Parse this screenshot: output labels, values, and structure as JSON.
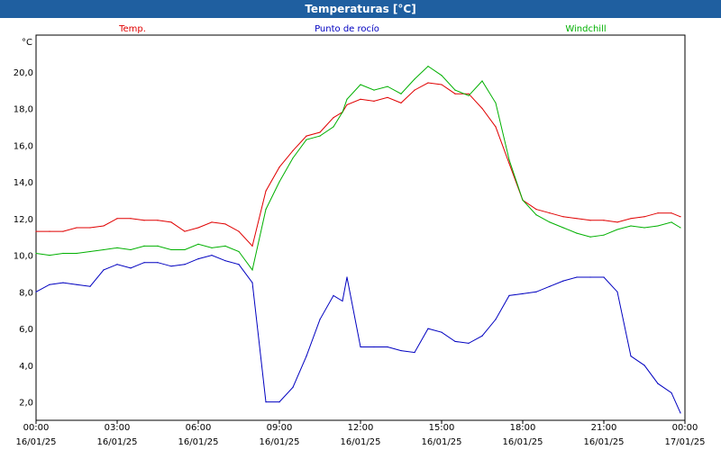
{
  "window": {
    "title": "Temperaturas [°C]"
  },
  "chart_data": {
    "type": "line",
    "title": "Temperaturas [°C]",
    "ylabel": "°C",
    "ylim": [
      1,
      22
    ],
    "xlim": [
      "16/01/25 00:00",
      "17/01/25 00:00"
    ],
    "grid": true,
    "legend": "top",
    "y_ticks": [
      "2,0",
      "4,0",
      "6,0",
      "8,0",
      "10,0",
      "12,0",
      "14,0",
      "16,0",
      "18,0",
      "20,0"
    ],
    "x_ticks": [
      {
        "time": "00:00",
        "date": "16/01/25"
      },
      {
        "time": "03:00",
        "date": "16/01/25"
      },
      {
        "time": "06:00",
        "date": "16/01/25"
      },
      {
        "time": "09:00",
        "date": "16/01/25"
      },
      {
        "time": "12:00",
        "date": "16/01/25"
      },
      {
        "time": "15:00",
        "date": "16/01/25"
      },
      {
        "time": "18:00",
        "date": "16/01/25"
      },
      {
        "time": "21:00",
        "date": "16/01/25"
      },
      {
        "time": "00:00",
        "date": "17/01/25"
      }
    ],
    "x": [
      "00:00",
      "00:30",
      "01:00",
      "01:30",
      "02:00",
      "02:30",
      "03:00",
      "03:30",
      "04:00",
      "04:30",
      "05:00",
      "05:30",
      "06:00",
      "06:30",
      "07:00",
      "07:30",
      "08:00",
      "08:30",
      "09:00",
      "09:30",
      "10:00",
      "10:30",
      "11:00",
      "11:20",
      "11:30",
      "12:00",
      "12:30",
      "13:00",
      "13:30",
      "14:00",
      "14:30",
      "15:00",
      "15:30",
      "16:00",
      "16:30",
      "17:00",
      "17:30",
      "18:00",
      "18:30",
      "19:00",
      "19:30",
      "20:00",
      "20:30",
      "21:00",
      "21:30",
      "22:00",
      "22:30",
      "23:00",
      "23:30",
      "23:50"
    ],
    "series": [
      {
        "name": "Temp.",
        "color": "#e00000",
        "values": [
          11.3,
          11.3,
          11.3,
          11.5,
          11.5,
          11.6,
          12.0,
          12.0,
          11.9,
          11.9,
          11.8,
          11.3,
          11.5,
          11.8,
          11.7,
          11.3,
          10.5,
          13.5,
          14.8,
          15.7,
          16.5,
          16.7,
          17.5,
          17.8,
          18.2,
          18.5,
          18.4,
          18.6,
          18.3,
          19.0,
          19.4,
          19.3,
          18.8,
          18.8,
          18.0,
          17.0,
          15.0,
          13.0,
          12.5,
          12.3,
          12.1,
          12.0,
          11.9,
          11.9,
          11.8,
          12.0,
          12.1,
          12.3,
          12.3,
          12.1
        ]
      },
      {
        "name": "Punto de rocío",
        "color": "#0000c0",
        "values": [
          8.0,
          8.4,
          8.5,
          8.4,
          8.3,
          9.2,
          9.5,
          9.3,
          9.6,
          9.6,
          9.4,
          9.5,
          9.8,
          10.0,
          9.7,
          9.5,
          8.5,
          2.0,
          2.0,
          2.8,
          4.5,
          6.5,
          7.8,
          7.5,
          8.8,
          5.0,
          5.0,
          5.0,
          4.8,
          4.7,
          6.0,
          5.8,
          5.3,
          5.2,
          5.6,
          6.5,
          7.8,
          7.9,
          8.0,
          8.3,
          8.6,
          8.8,
          8.8,
          8.8,
          8.0,
          4.5,
          4.0,
          3.0,
          2.5,
          1.4
        ]
      },
      {
        "name": "Windchill",
        "color": "#00b000",
        "values": [
          10.1,
          10.0,
          10.1,
          10.1,
          10.2,
          10.3,
          10.4,
          10.3,
          10.5,
          10.5,
          10.3,
          10.3,
          10.6,
          10.4,
          10.5,
          10.2,
          9.2,
          12.5,
          14.0,
          15.3,
          16.3,
          16.5,
          17.0,
          17.8,
          18.5,
          19.3,
          19.0,
          19.2,
          18.8,
          19.6,
          20.3,
          19.8,
          19.0,
          18.7,
          19.5,
          18.3,
          15.2,
          13.0,
          12.2,
          11.8,
          11.5,
          11.2,
          11.0,
          11.1,
          11.4,
          11.6,
          11.5,
          11.6,
          11.8,
          11.5
        ]
      }
    ]
  }
}
